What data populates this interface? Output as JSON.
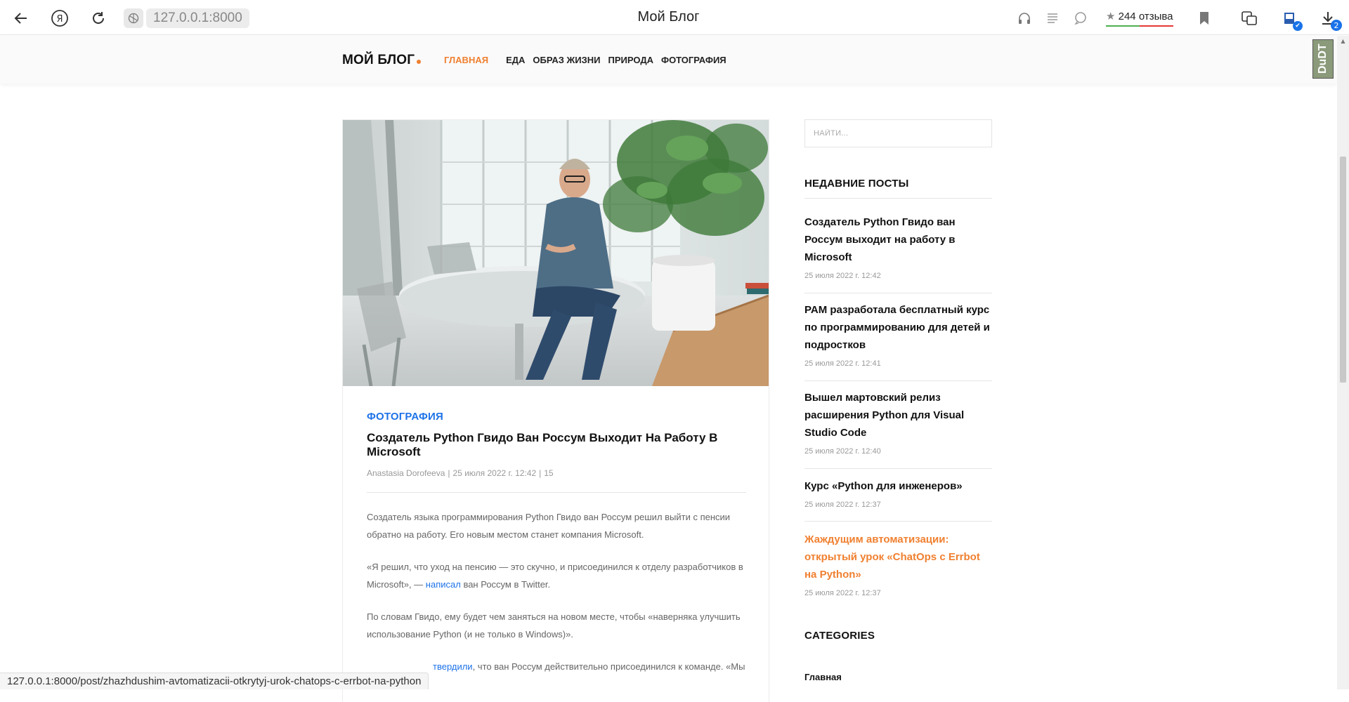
{
  "browser": {
    "url": "127.0.0.1:8000",
    "tab_title": "Мой Блог",
    "reviews_count": "244",
    "reviews_label": "отзыва",
    "downloads_badge": "2",
    "status_url": "127.0.0.1:8000/post/zhazhdushim-avtomatizacii-otkrytyj-urok-chatops-c-errbot-na-python"
  },
  "site": {
    "logo": "МОЙ БЛОГ",
    "nav": [
      "ГЛАВНАЯ",
      "ЕДА",
      "ОБРАЗ ЖИЗНИ",
      "ПРИРОДА",
      "ФОТОГРАФИЯ"
    ],
    "accent_color": "#f08030",
    "link_color": "#1e73e8"
  },
  "post": {
    "category": "ФОТОГРАФИЯ",
    "title": "Создатель Python Гвидо Ван Россум Выходит На Работу В Microsoft",
    "author": "Anastasia Dorofeeva",
    "date": "25 июля 2022 г. 12:42",
    "views": "15",
    "p1": "Создатель языка программирования Python Гвидо ван Россум решил выйти с пенсии обратно на работу. Его новым местом станет компания Microsoft.",
    "p2_before": "«Я решил, что уход на пенсию — это скучно, и присоединился к отделу разработчиков в Microsoft», — ",
    "p2_link": "написал",
    "p2_after": " ван Россум в Twitter.",
    "p3": "По словам Гвидо, ему будет чем заняться на новом месте, чтобы «наверняка улучшить использование Python (и не только в Windows)».",
    "p4_link": "твердили",
    "p4_after": ", что ван Россум действительно присоединился к команде. «Мы"
  },
  "sidebar": {
    "search_placeholder": "НАЙТИ...",
    "recent_heading": "НЕДАВНИЕ ПОСТЫ",
    "recent_posts": [
      {
        "title": "Создатель Python Гвидо ван Россум выходит на работу в Microsoft",
        "date": "25 июля 2022 г. 12:42"
      },
      {
        "title": "PAM разработала бесплатный курс по программированию для детей и подростков",
        "date": "25 июля 2022 г. 12:41"
      },
      {
        "title": "Вышел мартовский релиз расширения Python для Visual Studio Code",
        "date": "25 июля 2022 г. 12:40"
      },
      {
        "title": "Курс «Python для инженеров»",
        "date": "25 июля 2022 г. 12:37"
      },
      {
        "title": "Жаждущим автоматизации: открытый урок «ChatOps с Errbot на Python»",
        "date": "25 июля 2022 г. 12:37"
      }
    ],
    "categories_heading": "CATEGORIES",
    "categories": [
      "Главная"
    ]
  },
  "extension": {
    "label": "DuDT"
  }
}
